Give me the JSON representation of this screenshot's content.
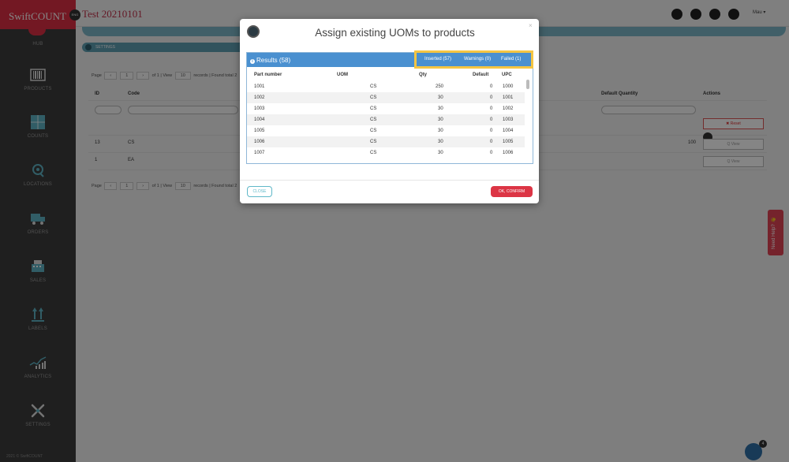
{
  "brand": "SwiftCOUNT",
  "project": {
    "badge": "ENG",
    "title": "Test 20210101"
  },
  "user_menu": "Mau ▾",
  "sidebar": {
    "items": [
      {
        "label": "HUB",
        "icon": "hub-icon"
      },
      {
        "label": "PRODUCTS",
        "icon": "barcode-icon"
      },
      {
        "label": "COUNTS",
        "icon": "grid-count-icon"
      },
      {
        "label": "LOCATIONS",
        "icon": "location-pin-icon"
      },
      {
        "label": "ORDERS",
        "icon": "truck-icon"
      },
      {
        "label": "SALES",
        "icon": "cash-register-icon"
      },
      {
        "label": "LABELS",
        "icon": "label-arrows-icon"
      },
      {
        "label": "ANALYTICS",
        "icon": "chart-icon"
      },
      {
        "label": "SETTINGS",
        "icon": "tools-icon"
      }
    ],
    "footer": "2021 © SwiftCOUNT"
  },
  "background_page": {
    "settings_label": "SETTINGS",
    "pager_top": {
      "page_label": "Page",
      "page_value": "1",
      "of_text": "of 1 | View",
      "view_value": "10",
      "records_text": "records | Found total 2"
    },
    "pager_bottom": {
      "page_label": "Page",
      "page_value": "1",
      "of_text": "of 1 | View",
      "view_value": "10",
      "records_text": "records | Found total 2"
    },
    "table": {
      "headers": {
        "id": "ID",
        "code": "Code",
        "default_quantity": "Default Quantity",
        "actions": "Actions"
      },
      "reset_label": "✖ Reset",
      "rows": [
        {
          "id": "13",
          "code": "CS",
          "default_quantity": "100",
          "action": "Q View"
        },
        {
          "id": "1",
          "code": "EA",
          "default_quantity": "",
          "action": "Q View"
        }
      ]
    }
  },
  "help_tab": "Need Help? 👋",
  "chat_count": "4",
  "modal": {
    "title": "Assign existing UOMs to products",
    "close_x": "×",
    "results_title": "Results (58)",
    "summary": {
      "inserted": "Inserted (57)",
      "warnings": "Warnings (0)",
      "failed": "Failed (1)"
    },
    "columns": {
      "part_number": "Part number",
      "uom": "UOM",
      "qty": "Qty",
      "default": "Default",
      "upc": "UPC"
    },
    "rows": [
      {
        "part_number": "1001",
        "uom": "CS",
        "qty": "250",
        "default": "0",
        "upc": "1000"
      },
      {
        "part_number": "1002",
        "uom": "CS",
        "qty": "30",
        "default": "0",
        "upc": "1001"
      },
      {
        "part_number": "1003",
        "uom": "CS",
        "qty": "30",
        "default": "0",
        "upc": "1002"
      },
      {
        "part_number": "1004",
        "uom": "CS",
        "qty": "30",
        "default": "0",
        "upc": "1003"
      },
      {
        "part_number": "1005",
        "uom": "CS",
        "qty": "30",
        "default": "0",
        "upc": "1004"
      },
      {
        "part_number": "1006",
        "uom": "CS",
        "qty": "30",
        "default": "0",
        "upc": "1005"
      },
      {
        "part_number": "1007",
        "uom": "CS",
        "qty": "30",
        "default": "0",
        "upc": "1006"
      }
    ],
    "close_button": "CLOSE",
    "confirm_button": "OK, CONFIRM"
  },
  "colors": {
    "brand_red": "#dc2f43",
    "sidebar_bg": "#3c3c3c",
    "results_blue": "#4a90d0",
    "highlight_yellow": "#f5c542",
    "confirm_red": "#dc3545"
  }
}
